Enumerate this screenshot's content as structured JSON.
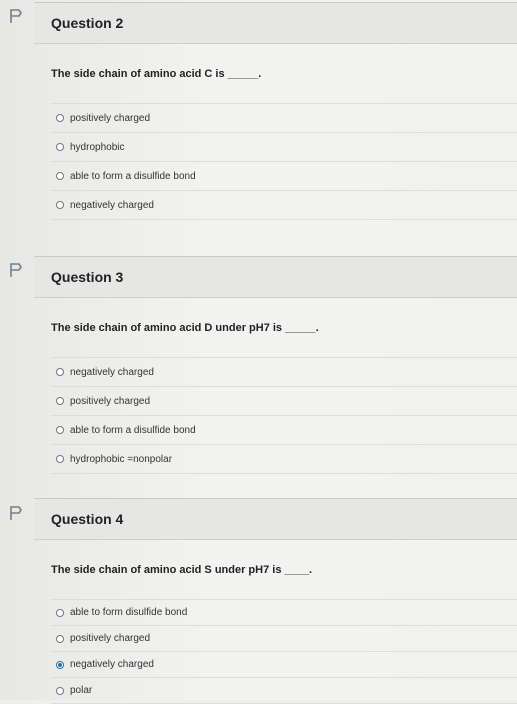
{
  "questions": [
    {
      "title": "Question 2",
      "text": "The side chain of amino acid C is _____.",
      "answers": [
        "positively charged",
        "hydrophobic",
        "able to form a disulfide bond",
        "negatively charged"
      ],
      "selected": null
    },
    {
      "title": "Question 3",
      "text": "The side chain of amino acid D under pH7 is _____.",
      "answers": [
        "negatively charged",
        "positively charged",
        "able to form a disulfide bond",
        "hydrophobic =nonpolar"
      ],
      "selected": null
    },
    {
      "title": "Question 4",
      "text": "The side chain of amino acid S under pH7 is ____.",
      "answers": [
        "able to form disulfide bond",
        "positively charged",
        "negatively charged",
        "polar"
      ],
      "selected": 2
    }
  ],
  "icons": {
    "flag": "flag-question-icon",
    "radio": "radio-button-icon"
  },
  "colors": {
    "accent": "#2c6ea0",
    "header_bg": "#e6e6e4"
  }
}
